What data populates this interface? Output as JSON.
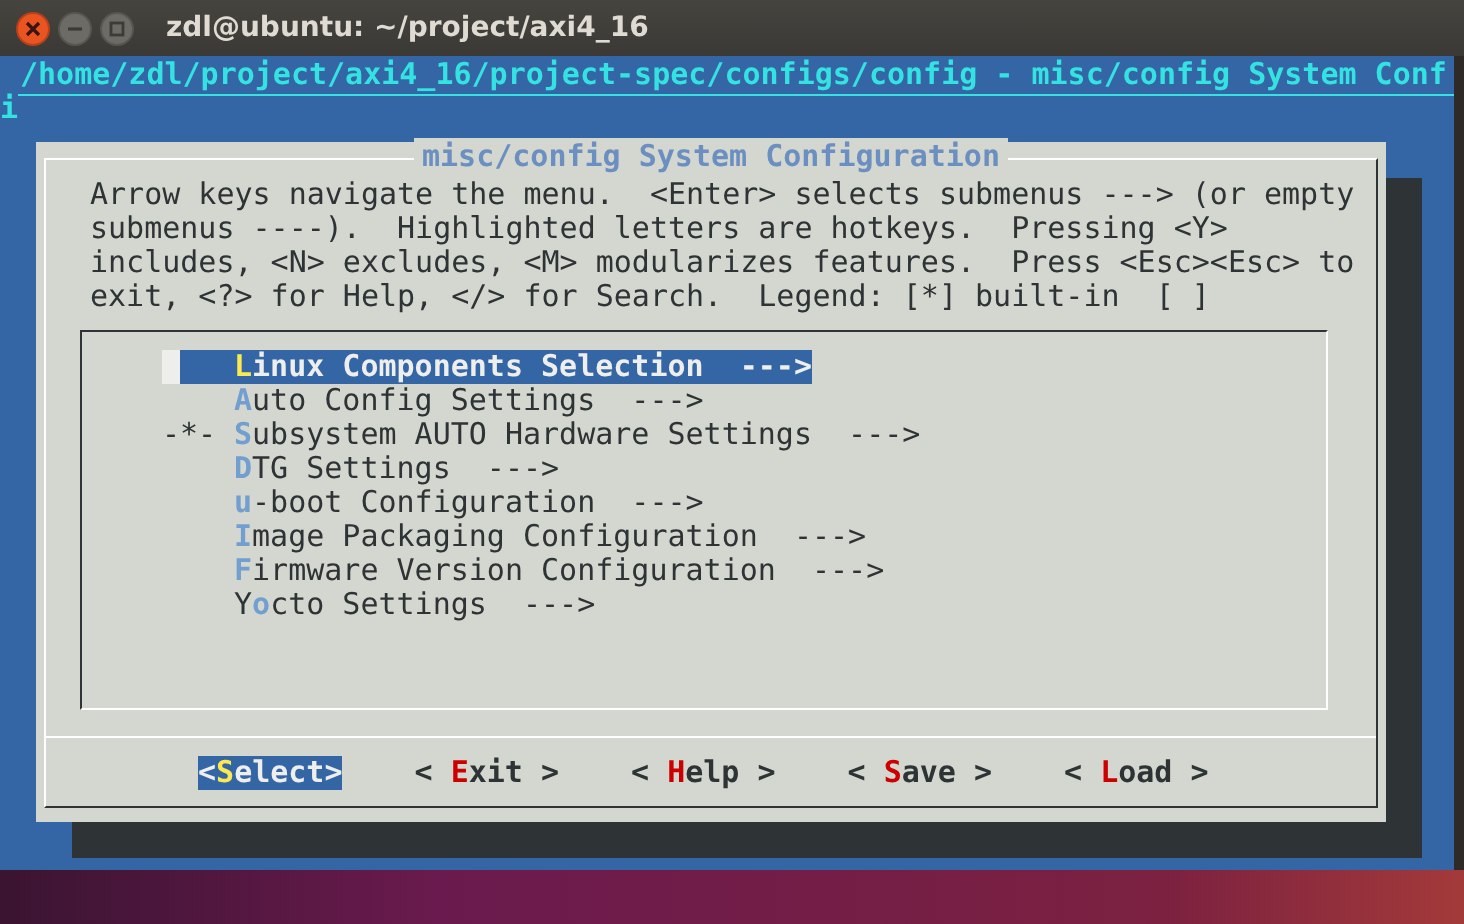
{
  "window": {
    "title": "zdl@ubuntu: ~/project/axi4_16"
  },
  "terminal": {
    "path_line": "/home/zdl/project/axi4_16/project-spec/configs/config - misc/config System Conf",
    "wrap_line": "i"
  },
  "dialog": {
    "title": "misc/config System Configuration",
    "help_lines": [
      "Arrow keys navigate the menu.  <Enter> selects submenus ---> (or empty",
      "submenus ----).  Highlighted letters are hotkeys.  Pressing <Y>",
      "includes, <N> excludes, <M> modularizes features.  Press <Esc><Esc> to",
      "exit, <?> for Help, </> for Search.  Legend: [*] built-in  [ ]"
    ],
    "items": [
      {
        "hotkey": "L",
        "after": "inux Components Selection",
        "arrow": "--->",
        "selected": true
      },
      {
        "hotkey": "A",
        "after": "uto Config Settings",
        "arrow": "--->",
        "selected": false
      },
      {
        "marker": "-*-",
        "hotkey": "S",
        "after": "ubsystem AUTO Hardware Settings",
        "arrow": "--->",
        "selected": false
      },
      {
        "hotkey": "D",
        "after": "TG Settings",
        "arrow": "--->",
        "selected": false
      },
      {
        "hotkey": "u",
        "after": "-boot Configuration",
        "arrow": "--->",
        "selected": false
      },
      {
        "hotkey": "I",
        "after": "mage Packaging Configuration",
        "arrow": "--->",
        "selected": false
      },
      {
        "hotkey": "F",
        "after": "irmware Version Configuration",
        "arrow": "--->",
        "selected": false
      },
      {
        "before": "Y",
        "hotkey": "o",
        "after": "cto Settings",
        "arrow": "--->",
        "selected": false
      }
    ],
    "buttons": [
      {
        "pre": "<",
        "hotkey": "S",
        "post": "elect>",
        "selected": true
      },
      {
        "pre": "< ",
        "hotkey": "E",
        "post": "xit >",
        "selected": false
      },
      {
        "pre": "< ",
        "hotkey": "H",
        "post": "elp >",
        "selected": false
      },
      {
        "pre": "< ",
        "hotkey": "S",
        "post": "ave >",
        "selected": false
      },
      {
        "pre": "< ",
        "hotkey": "L",
        "post": "oad >",
        "selected": false
      }
    ]
  }
}
